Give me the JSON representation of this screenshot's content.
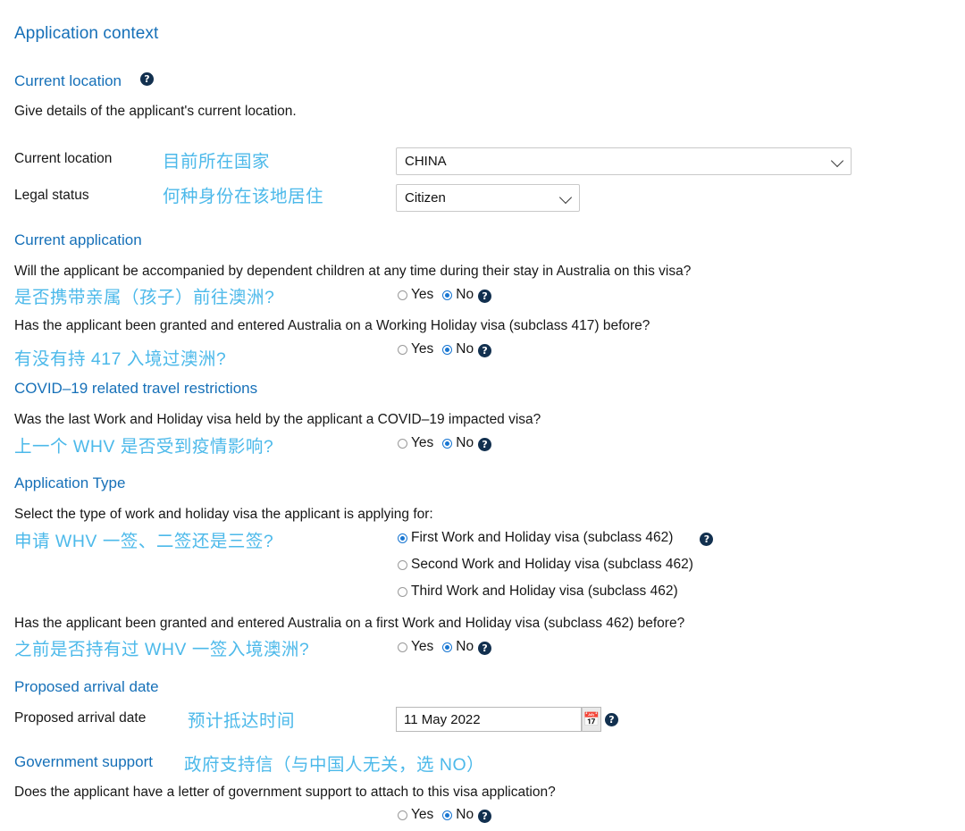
{
  "page": {
    "title": "Application context"
  },
  "colors": {
    "heading_blue": "#1670b8",
    "annotation_cyan": "#4cb9ea",
    "help_icon_navy": "#12304f",
    "radio_selected": "#1876d2"
  },
  "sections": {
    "current_location": {
      "heading": "Current location",
      "help_icon": "help-circle-icon",
      "description": "Give details of the applicant's current location.",
      "fields": [
        {
          "label": "Current location",
          "annotation": "目前所在国家",
          "value": "CHINA",
          "control": "select"
        },
        {
          "label": "Legal status",
          "annotation": "何种身份在该地居住",
          "value": "Citizen",
          "control": "select"
        }
      ]
    },
    "current_application": {
      "heading": "Current application",
      "questions": [
        {
          "text": "Will the applicant be accompanied by dependent children at any time during their stay in Australia on this visa?",
          "annotation": "是否携带亲属（孩子）前往澳洲?",
          "yes_label": "Yes",
          "no_label": "No",
          "selected": "No"
        },
        {
          "text": "Has the applicant been granted and entered Australia on a Working Holiday visa (subclass 417) before?",
          "annotation": "有没有持 417 入境过澳洲?",
          "yes_label": "Yes",
          "no_label": "No",
          "selected": "No"
        }
      ]
    },
    "covid": {
      "heading": "COVID–19 related travel restrictions",
      "question": {
        "text": "Was the last Work and Holiday visa held by the applicant a COVID–19 impacted visa?",
        "annotation": "上一个 WHV 是否受到疫情影响?",
        "yes_label": "Yes",
        "no_label": "No",
        "selected": "No"
      }
    },
    "application_type": {
      "heading": "Application Type",
      "prompt": "Select the type of work and holiday visa the applicant is applying for:",
      "annotation": "申请 WHV 一签、二签还是三签?",
      "options": [
        {
          "label": "First Work and Holiday visa (subclass 462)",
          "selected": true
        },
        {
          "label": "Second Work and Holiday visa (subclass 462)",
          "selected": false
        },
        {
          "label": "Third Work and Holiday visa (subclass 462)",
          "selected": false
        }
      ],
      "followup": {
        "text": "Has the applicant been granted and entered Australia on a first Work and Holiday visa (subclass 462) before?",
        "annotation": "之前是否持有过 WHV 一签入境澳洲?",
        "yes_label": "Yes",
        "no_label": "No",
        "selected": "No"
      }
    },
    "proposed_arrival_date": {
      "heading": "Proposed arrival date",
      "label": "Proposed arrival date",
      "annotation": "预计抵达时间",
      "value": "11 May 2022",
      "calendar_icon": "calendar-icon"
    },
    "government_support": {
      "heading": "Government support",
      "annotation": "政府支持信（与中国人无关，选 NO）",
      "question": {
        "text": "Does the applicant have a letter of government support to attach to this visa application?",
        "yes_label": "Yes",
        "no_label": "No",
        "selected": "No"
      }
    }
  }
}
